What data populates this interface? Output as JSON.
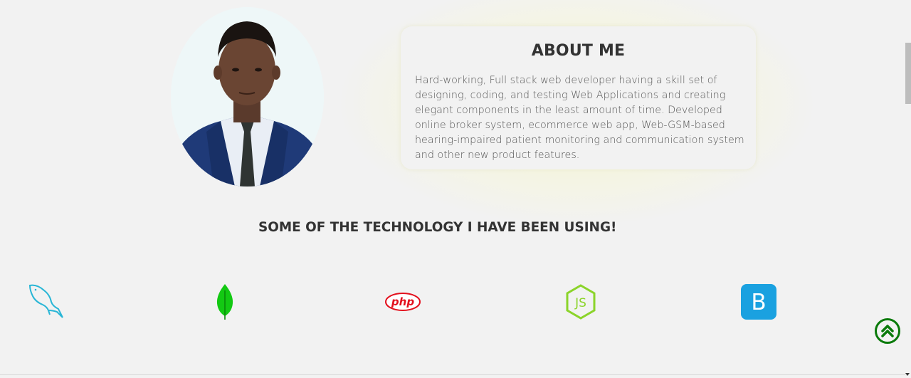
{
  "about": {
    "title": "ABOUT ME",
    "body": "Hard-working, Full stack web developer having a skill set of designing, coding, and testing Web Applications and creating elegant components in the least amount of time. Developed online broker system, ecommerce web app, Web-GSM-based hearing-impaired patient monitoring and communication system and other new product features."
  },
  "tech": {
    "heading": "SOME OF THE TECHNOLOGY I HAVE BEEN USING!",
    "icons": [
      {
        "name": "mysql-dolphin-icon",
        "color": "#29b6d6"
      },
      {
        "name": "mongodb-leaf-icon",
        "color": "#13c913"
      },
      {
        "name": "php-icon",
        "color": "#e3101d",
        "label": "php"
      },
      {
        "name": "nodejs-icon",
        "color": "#8bd42a",
        "label": "JS"
      },
      {
        "name": "bootstrap-icon",
        "color": "#1aa1e0",
        "label": "B"
      }
    ]
  },
  "scroll_top": {
    "icon": "double-chevron-up-icon",
    "color": "#0a7a0a"
  }
}
